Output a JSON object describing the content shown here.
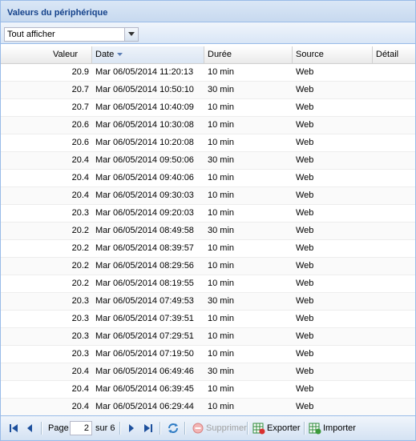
{
  "panel": {
    "title": "Valeurs du périphérique"
  },
  "filter": {
    "selected": "Tout afficher"
  },
  "columns": {
    "valeur": "Valeur",
    "date": "Date",
    "duree": "Durée",
    "source": "Source",
    "detail": "Détail"
  },
  "rows": [
    {
      "valeur": "20.9",
      "date": "Mar 06/05/2014 11:20:13",
      "duree": "10 min",
      "source": "Web",
      "detail": ""
    },
    {
      "valeur": "20.7",
      "date": "Mar 06/05/2014 10:50:10",
      "duree": "30 min",
      "source": "Web",
      "detail": ""
    },
    {
      "valeur": "20.7",
      "date": "Mar 06/05/2014 10:40:09",
      "duree": "10 min",
      "source": "Web",
      "detail": ""
    },
    {
      "valeur": "20.6",
      "date": "Mar 06/05/2014 10:30:08",
      "duree": "10 min",
      "source": "Web",
      "detail": ""
    },
    {
      "valeur": "20.6",
      "date": "Mar 06/05/2014 10:20:08",
      "duree": "10 min",
      "source": "Web",
      "detail": ""
    },
    {
      "valeur": "20.4",
      "date": "Mar 06/05/2014 09:50:06",
      "duree": "30 min",
      "source": "Web",
      "detail": ""
    },
    {
      "valeur": "20.4",
      "date": "Mar 06/05/2014 09:40:06",
      "duree": "10 min",
      "source": "Web",
      "detail": ""
    },
    {
      "valeur": "20.4",
      "date": "Mar 06/05/2014 09:30:03",
      "duree": "10 min",
      "source": "Web",
      "detail": ""
    },
    {
      "valeur": "20.3",
      "date": "Mar 06/05/2014 09:20:03",
      "duree": "10 min",
      "source": "Web",
      "detail": ""
    },
    {
      "valeur": "20.2",
      "date": "Mar 06/05/2014 08:49:58",
      "duree": "30 min",
      "source": "Web",
      "detail": ""
    },
    {
      "valeur": "20.2",
      "date": "Mar 06/05/2014 08:39:57",
      "duree": "10 min",
      "source": "Web",
      "detail": ""
    },
    {
      "valeur": "20.2",
      "date": "Mar 06/05/2014 08:29:56",
      "duree": "10 min",
      "source": "Web",
      "detail": ""
    },
    {
      "valeur": "20.2",
      "date": "Mar 06/05/2014 08:19:55",
      "duree": "10 min",
      "source": "Web",
      "detail": ""
    },
    {
      "valeur": "20.3",
      "date": "Mar 06/05/2014 07:49:53",
      "duree": "30 min",
      "source": "Web",
      "detail": ""
    },
    {
      "valeur": "20.3",
      "date": "Mar 06/05/2014 07:39:51",
      "duree": "10 min",
      "source": "Web",
      "detail": ""
    },
    {
      "valeur": "20.3",
      "date": "Mar 06/05/2014 07:29:51",
      "duree": "10 min",
      "source": "Web",
      "detail": ""
    },
    {
      "valeur": "20.3",
      "date": "Mar 06/05/2014 07:19:50",
      "duree": "10 min",
      "source": "Web",
      "detail": ""
    },
    {
      "valeur": "20.4",
      "date": "Mar 06/05/2014 06:49:46",
      "duree": "30 min",
      "source": "Web",
      "detail": ""
    },
    {
      "valeur": "20.4",
      "date": "Mar 06/05/2014 06:39:45",
      "duree": "10 min",
      "source": "Web",
      "detail": ""
    },
    {
      "valeur": "20.4",
      "date": "Mar 06/05/2014 06:29:44",
      "duree": "10 min",
      "source": "Web",
      "detail": ""
    }
  ],
  "pager": {
    "page_label": "Page",
    "current_page": "2",
    "of_label": "sur 6",
    "icons": [
      "first-page-icon",
      "prev-page-icon",
      "next-page-icon",
      "last-page-icon",
      "refresh-icon"
    ]
  },
  "actions": {
    "delete_label": "Supprimer",
    "export_label": "Exporter",
    "import_label": "Importer"
  },
  "colors": {
    "header_text": "#15428b",
    "border": "#99bbe8",
    "nav_icon": "#1c4f9c",
    "delete_icon": "#e07070",
    "export_icon": "#2e8b3a"
  }
}
